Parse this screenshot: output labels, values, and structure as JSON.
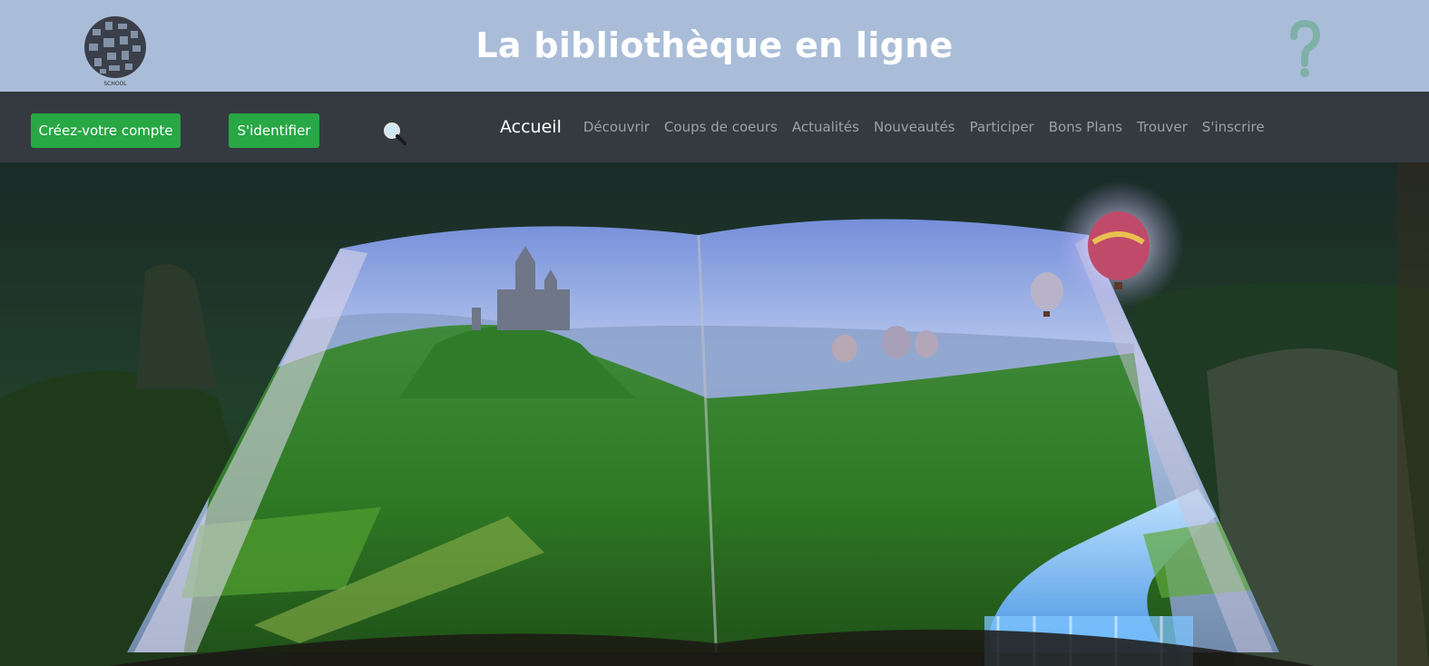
{
  "header": {
    "title": "La bibliothèque en ligne",
    "logo_icon": "school-collage-logo",
    "help_icon": "question-mark-icon"
  },
  "navbar": {
    "create_account_label": "Créez-votre compte",
    "login_label": "S'identifier",
    "search_icon": "magnifier-icon",
    "items": [
      {
        "label": "Accueil",
        "active": true
      },
      {
        "label": "Découvrir"
      },
      {
        "label": "Coups de coeurs"
      },
      {
        "label": "Actualités"
      },
      {
        "label": "Nouveautés"
      },
      {
        "label": "Participer"
      },
      {
        "label": "Bons Plans"
      },
      {
        "label": "Trouver"
      },
      {
        "label": "S'inscrire"
      }
    ]
  },
  "hero": {
    "image": "open book with fantasy landscape, castle, hot air balloons and river"
  },
  "colors": {
    "header_bg": "#a9bdd8",
    "navbar_bg": "#343a40",
    "button_bg": "#28a745",
    "nav_active": "#ffffff",
    "nav_inactive": "#9aa1a8"
  }
}
